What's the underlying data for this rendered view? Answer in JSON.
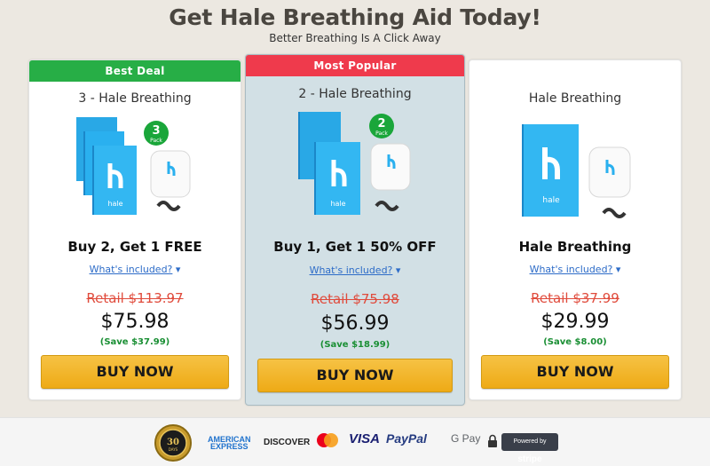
{
  "header": {
    "title": "Get Hale Breathing Aid Today!",
    "subtitle": "Better Breathing Is A Click Away"
  },
  "cards": [
    {
      "banner": "Best Deal",
      "name": "3 - Hale Breathing",
      "pack_badge_num": "3",
      "pack_badge_word": "Pack",
      "box_brand": "hale",
      "offer": "Buy 2, Get 1 FREE",
      "included": "What's included?",
      "retail": "Retail $113.97",
      "price": "$75.98",
      "save": "(Save $37.99)",
      "button": "BUY NOW"
    },
    {
      "banner": "Most Popular",
      "name": "2 - Hale Breathing",
      "pack_badge_num": "2",
      "pack_badge_word": "Pack",
      "box_brand": "hale",
      "offer": "Buy 1, Get 1 50% OFF",
      "included": "What's included?",
      "retail": "Retail $75.98",
      "price": "$56.99",
      "save": "(Save $18.99)",
      "button": "BUY NOW"
    },
    {
      "name": "Hale Breathing",
      "box_brand": "hale",
      "offer": "Hale Breathing",
      "included": "What's included?",
      "retail": "Retail $37.99",
      "price": "$29.99",
      "save": "(Save $8.00)",
      "button": "BUY NOW"
    }
  ],
  "footer": {
    "guarantee_days": "30",
    "guarantee_word": "DAYS",
    "payments": {
      "amex_line1": "AMERICAN",
      "amex_line2": "EXPRESS",
      "discover": "DISCOVER",
      "visa": "VISA",
      "paypal": "PayPal",
      "gpay": "G Pay",
      "stripe_prefix": "Powered by",
      "stripe_brand": "stripe"
    }
  },
  "colors": {
    "best_deal": "#27ae46",
    "most_popular": "#ef3a4c",
    "price_strike": "#e04b3c",
    "save_green": "#1a8f34",
    "button": "#f2b42a",
    "link": "#2d6cc8",
    "product_blue": "#29a8e6"
  }
}
